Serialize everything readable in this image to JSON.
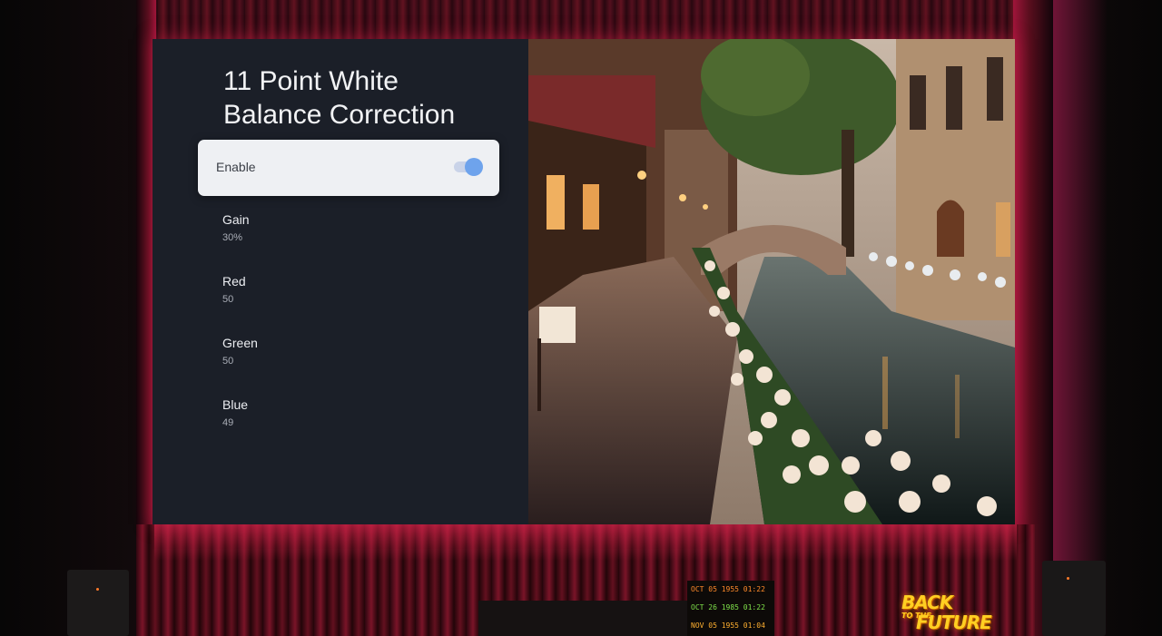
{
  "settings_panel": {
    "title_line1": "11 Point White",
    "title_line2": "Balance Correction",
    "enable_label": "Enable",
    "enable_on": true,
    "items": [
      {
        "label": "Gain",
        "value": "30%"
      },
      {
        "label": "Red",
        "value": "50"
      },
      {
        "label": "Green",
        "value": "50"
      },
      {
        "label": "Blue",
        "value": "49"
      }
    ]
  },
  "colors": {
    "panel_bg": "#1b1f28",
    "focused_row_bg": "#eef0f3",
    "toggle_on": "#6ea3ec",
    "ambient_red": "#a0153a"
  },
  "props": {
    "clock_lines": [
      "OCT 05  1955  01:22",
      "OCT 26  1985  01:22",
      "NOV 05  1955  01:04"
    ],
    "poster_line1": "BACK",
    "poster_line2": "TO THE",
    "poster_line3": "FUTURE"
  }
}
